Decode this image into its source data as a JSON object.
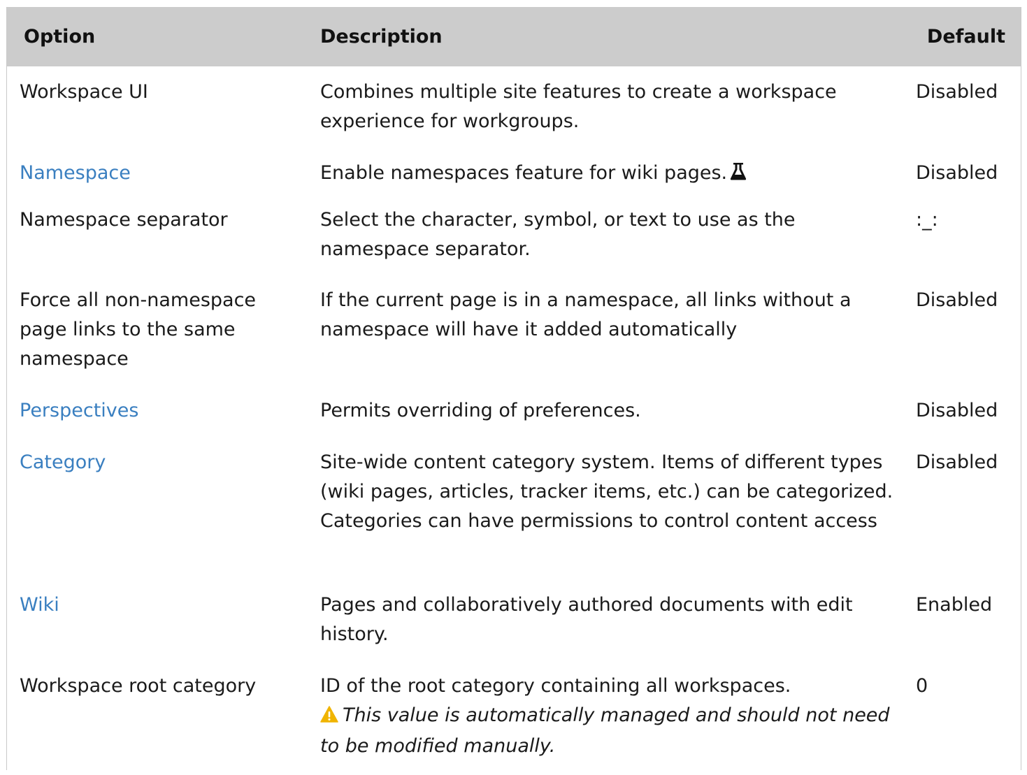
{
  "table": {
    "headers": {
      "option": "Option",
      "description": "Description",
      "default": "Default"
    },
    "rows": [
      {
        "option": "Workspace UI",
        "option_is_link": false,
        "description": "Combines multiple site features to create a workspace experience for workgroups.",
        "default": "Disabled"
      },
      {
        "option": "Namespace",
        "option_is_link": true,
        "description": "Enable namespaces feature for wiki pages.",
        "description_icon": "flask-icon",
        "default": "Disabled"
      },
      {
        "option": "Namespace separator",
        "option_is_link": false,
        "description": "Select the character, symbol, or text to use as the namespace separator.",
        "default": ":_:"
      },
      {
        "option": "Force all non-namespace page links to the same namespace",
        "option_is_link": false,
        "description": "If the current page is in a namespace, all links without a namespace will have it added automatically",
        "default": "Disabled"
      },
      {
        "option": "Perspectives",
        "option_is_link": true,
        "description": "Permits overriding of preferences.",
        "default": "Disabled"
      },
      {
        "option": "Category",
        "option_is_link": true,
        "description": "Site-wide content category system. Items of different types (wiki pages, articles, tracker items, etc.) can be categorized. Categories can have permissions to control content access",
        "default": "Disabled"
      },
      {
        "option": "Wiki",
        "option_is_link": true,
        "description": "Pages and collaboratively authored documents with edit history.",
        "default": "Enabled"
      },
      {
        "option": "Workspace root category",
        "option_is_link": false,
        "description": "ID of the root category containing all workspaces.",
        "note": "This value is automatically managed and should not need to be modified manually.",
        "note_icon": "warning-icon",
        "default": "0"
      }
    ]
  },
  "colors": {
    "header_bg": "#cccccc",
    "link": "#3a7fc0",
    "warning": "#f0b400",
    "text": "#1a1a1a"
  }
}
